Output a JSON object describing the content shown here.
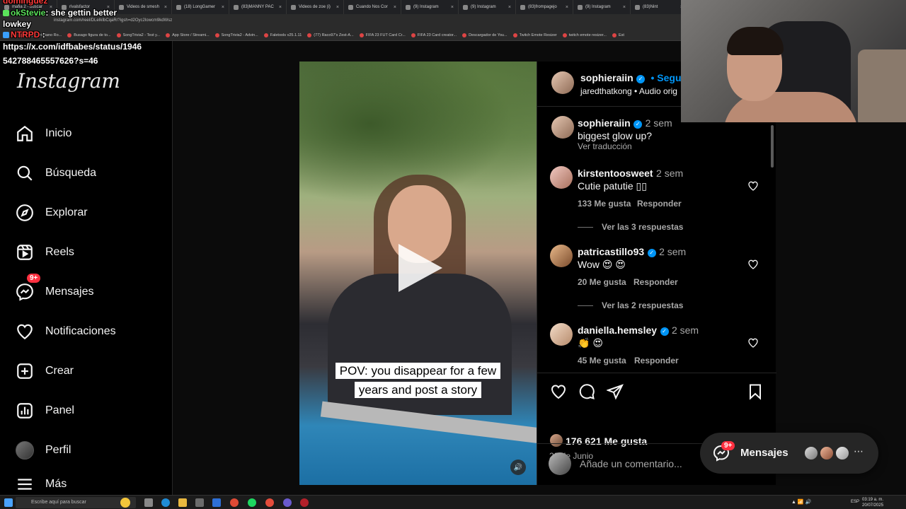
{
  "browser": {
    "tabs": [
      "mafia 2 - buscar",
      "rivalsfactor",
      "Videos de smesh",
      "(18) LongGamer",
      "(83)MANNY PAC",
      "Videos de zoe (i)",
      "Cuando Nos Cor",
      "(9) Instagram",
      "(9) Instagram",
      "(83)frompagejo",
      "(9) Instagram",
      "(83)Nint"
    ],
    "url": "instagram.com/reel/DLeIkIbCqaR/?igsh=d2Oyc2lowcm9kdWsz",
    "bookmarks": [
      "Happy Cristiano Ro...",
      "Busago figura de to...",
      "SongTrivia2 - Test y...",
      "App Store / Streami...",
      "SongTrivia2 - Advin...",
      "Faletools v25.1.11",
      "(77) Raco97's Zest-A...",
      "FIFA 23 FUT Card Cr...",
      "FIFA 23 Card creator...",
      "Descargador de You...",
      "Twitch Emote Resizer",
      "twitch emote resizer...",
      "Est"
    ]
  },
  "chat": {
    "line1_user": "dominguez",
    "line2_user": "okStevie",
    "line2_text": ": she gettin better",
    "line3_text": "lowkey",
    "line4_user": "NTRPD",
    "line4_colon": ":",
    "line5_text": "https://x.com/idfbabes/status/1946",
    "line6_text": "542788465557626?s=46"
  },
  "sidebar": {
    "logo": "Instagram",
    "items": [
      {
        "label": "Inicio",
        "icon": "home-icon"
      },
      {
        "label": "Búsqueda",
        "icon": "search-icon"
      },
      {
        "label": "Explorar",
        "icon": "compass-icon"
      },
      {
        "label": "Reels",
        "icon": "reels-icon"
      },
      {
        "label": "Mensajes",
        "icon": "messenger-icon",
        "badge": "9+"
      },
      {
        "label": "Notificaciones",
        "icon": "heart-icon"
      },
      {
        "label": "Crear",
        "icon": "plus-square-icon"
      },
      {
        "label": "Panel",
        "icon": "chart-icon"
      },
      {
        "label": "Perfil",
        "icon": "avatar"
      },
      {
        "label": "Más",
        "icon": "menu-icon"
      }
    ]
  },
  "post": {
    "caption_overlay_line1": "POV: you disappear for a few",
    "caption_overlay_line2": "years and post a story",
    "author": "sophieraiin",
    "follow_label": "Seguir",
    "audio": "jaredthatkong • Audio orig",
    "caption": {
      "user": "sophieraiin",
      "time": "2 sem",
      "text": "biggest glow up?",
      "translate": "Ver traducción"
    },
    "comments": [
      {
        "user": "kirstentoosweet",
        "verified": false,
        "time": "2 sem",
        "text": "Cutie patutie ▯▯",
        "likes": "133 Me gusta",
        "reply": "Responder",
        "view_replies": "Ver las 3 respuestas"
      },
      {
        "user": "patricastillo93",
        "verified": true,
        "time": "2 sem",
        "text": "Wow 😍 😍",
        "likes": "20 Me gusta",
        "reply": "Responder",
        "view_replies": "Ver las 2 respuestas"
      },
      {
        "user": "daniella.hemsley",
        "verified": true,
        "time": "2 sem",
        "text": "👏 😍",
        "likes": "45 Me gusta",
        "reply": "Responder"
      }
    ],
    "likes": "176 621 Me gusta",
    "date": "29 de Junio",
    "comment_placeholder": "Añade un comentario..."
  },
  "messages_pill": {
    "label": "Mensajes",
    "badge": "9+"
  },
  "taskbar": {
    "search_placeholder": "Escribe aquí para buscar",
    "time": "03:19 a. m.",
    "date": "20/07/2025",
    "lang": "ESP"
  },
  "colors": {
    "accent": "#0095f6",
    "badge": "#ff3040",
    "background": "#000000"
  }
}
